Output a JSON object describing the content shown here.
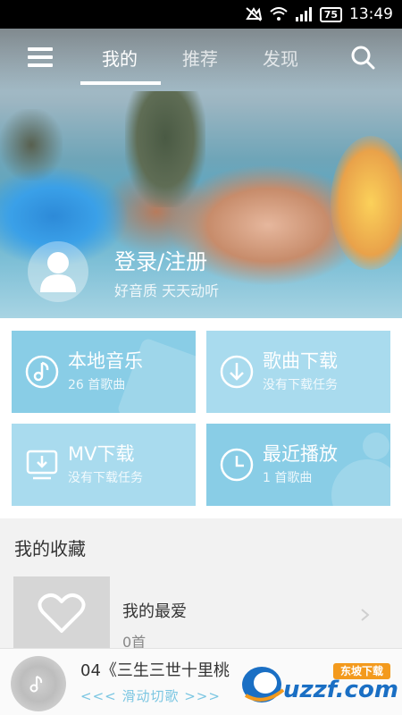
{
  "status_bar": {
    "time": "13:49",
    "battery": "75"
  },
  "nav": {
    "tabs": [
      {
        "label": "我的"
      },
      {
        "label": "推荐"
      },
      {
        "label": "发现"
      }
    ]
  },
  "user": {
    "login_label": "登录/注册",
    "slogan": "好音质 天天动听"
  },
  "tiles": [
    {
      "title": "本地音乐",
      "desc": "26 首歌曲"
    },
    {
      "title": "歌曲下载",
      "desc": "没有下载任务"
    },
    {
      "title": "MV下载",
      "desc": "没有下载任务"
    },
    {
      "title": "最近播放",
      "desc": "1 首歌曲"
    }
  ],
  "favorites": {
    "section_title": "我的收藏",
    "items": [
      {
        "name": "我的最爱",
        "count": "0首"
      }
    ]
  },
  "player": {
    "song": "04《三生三世十里桃",
    "swipe_hint": "<<< 滑动切歌 >>>"
  },
  "watermark": {
    "text": "uzzf.com",
    "tag": "东坡下载"
  },
  "colors": {
    "tile": "#89cde6",
    "tile_alt": "#a9dbee",
    "accent": "#7bc6e2"
  }
}
